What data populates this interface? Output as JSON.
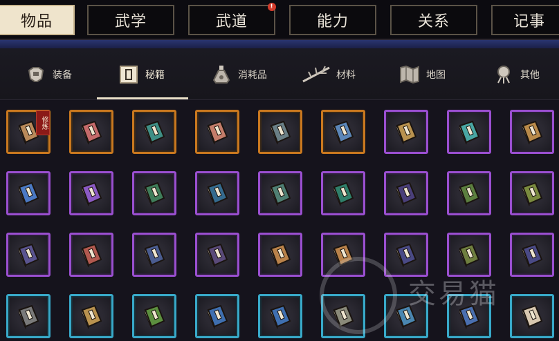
{
  "tabs": [
    {
      "id": "items",
      "label": "物品",
      "active": true
    },
    {
      "id": "martial",
      "label": "武学"
    },
    {
      "id": "dao",
      "label": "武道",
      "badge": "!"
    },
    {
      "id": "ability",
      "label": "能力"
    },
    {
      "id": "relation",
      "label": "关系"
    },
    {
      "id": "journal",
      "label": "记事"
    }
  ],
  "subtabs": [
    {
      "id": "equipment",
      "label": "装备",
      "icon": "armor-icon"
    },
    {
      "id": "manuals",
      "label": "秘籍",
      "icon": "manual-icon",
      "active": true
    },
    {
      "id": "consumables",
      "label": "消耗品",
      "icon": "potion-icon"
    },
    {
      "id": "materials",
      "label": "材料",
      "icon": "herb-icon"
    },
    {
      "id": "maps",
      "label": "地图",
      "icon": "map-icon"
    },
    {
      "id": "other",
      "label": "其他",
      "icon": "bell-icon"
    }
  ],
  "rarity_colors": {
    "orange": "#c9781f",
    "purple": "#9a4fd0",
    "cyan": "#38a9c9"
  },
  "inventory": [
    {
      "rarity": "orange",
      "color": "#b98a5a",
      "tag": "修炼"
    },
    {
      "rarity": "orange",
      "color": "#c46a6a"
    },
    {
      "rarity": "orange",
      "color": "#3f8f86"
    },
    {
      "rarity": "orange",
      "color": "#c47d6a"
    },
    {
      "rarity": "orange",
      "color": "#6a7f86"
    },
    {
      "rarity": "orange",
      "color": "#5b86b8"
    },
    {
      "rarity": "purple",
      "color": "#b9924f"
    },
    {
      "rarity": "purple",
      "color": "#49a6a3"
    },
    {
      "rarity": "purple",
      "color": "#b98a4a"
    },
    {
      "rarity": "purple",
      "color": "#4b79c4"
    },
    {
      "rarity": "purple",
      "color": "#8b5ac4"
    },
    {
      "rarity": "purple",
      "color": "#3f7d5a"
    },
    {
      "rarity": "purple",
      "color": "#356b8f"
    },
    {
      "rarity": "purple",
      "color": "#4f7f73"
    },
    {
      "rarity": "purple",
      "color": "#2f7f6a"
    },
    {
      "rarity": "purple",
      "color": "#4a3f7a"
    },
    {
      "rarity": "purple",
      "color": "#5c7f3f"
    },
    {
      "rarity": "purple",
      "color": "#7a8a3f"
    },
    {
      "rarity": "purple",
      "color": "#5a5490"
    },
    {
      "rarity": "purple",
      "color": "#b2594f"
    },
    {
      "rarity": "purple",
      "color": "#4a5c90"
    },
    {
      "rarity": "purple",
      "color": "#5a4a7a"
    },
    {
      "rarity": "purple",
      "color": "#b9824a"
    },
    {
      "rarity": "purple",
      "color": "#b9824a"
    },
    {
      "rarity": "purple",
      "color": "#4a4a86"
    },
    {
      "rarity": "purple",
      "color": "#6f7f3f"
    },
    {
      "rarity": "purple",
      "color": "#4a4a86"
    },
    {
      "rarity": "cyan",
      "color": "#7a7a7a"
    },
    {
      "rarity": "cyan",
      "color": "#b9924f"
    },
    {
      "rarity": "cyan",
      "color": "#5c8f3f"
    },
    {
      "rarity": "cyan",
      "color": "#3f6fb0"
    },
    {
      "rarity": "cyan",
      "color": "#3f6fb0"
    },
    {
      "rarity": "cyan",
      "color": "#8a8a7a"
    },
    {
      "rarity": "cyan",
      "color": "#4a86b0"
    },
    {
      "rarity": "cyan",
      "color": "#4a6fb0"
    },
    {
      "rarity": "cyan",
      "color": "#d8c8b0"
    }
  ],
  "watermark": "交易猫"
}
